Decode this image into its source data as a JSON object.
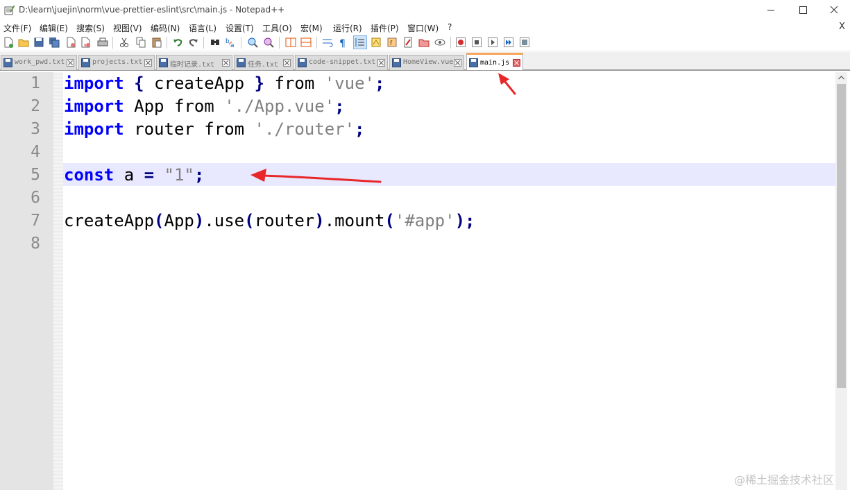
{
  "window": {
    "title": "D:\\learn\\juejin\\norm\\vue-prettier-eslint\\src\\main.js - Notepad++",
    "controls": [
      "minimize",
      "maximize",
      "close"
    ]
  },
  "menu": {
    "items": [
      "文件(F)",
      "编辑(E)",
      "搜索(S)",
      "视图(V)",
      "编码(N)",
      "语言(L)",
      "设置(T)",
      "工具(O)",
      "宏(M)",
      "运行(R)",
      "插件(P)",
      "窗口(W)",
      "?"
    ],
    "close_label": "X"
  },
  "toolbar": {
    "icons": [
      "new-file-icon",
      "open-file-icon",
      "save-icon",
      "save-all-icon",
      "close-icon",
      "close-all-icon",
      "print-icon",
      "cut-icon",
      "copy-icon",
      "paste-icon",
      "undo-icon",
      "redo-icon",
      "find-icon",
      "replace-icon",
      "zoom-in-icon",
      "zoom-out-icon",
      "sync-vertical-icon",
      "sync-horizontal-icon",
      "word-wrap-icon",
      "show-all-chars-icon",
      "indent-guide-icon",
      "udl-icon",
      "function-list-icon",
      "doc-map-icon",
      "folder-workspace-icon",
      "monitoring-icon",
      "record-macro-icon",
      "stop-record-icon",
      "play-macro-icon",
      "run-macro-multiple-icon",
      "save-macro-icon"
    ]
  },
  "tabs": [
    {
      "label": "work_pwd.txt",
      "active": false
    },
    {
      "label": "projects.txt",
      "active": false
    },
    {
      "label": "临时记录.txt",
      "active": false
    },
    {
      "label": "任务.txt",
      "active": false
    },
    {
      "label": "code-snippet.txt",
      "active": false
    },
    {
      "label": "HomeView.vue",
      "active": false
    },
    {
      "label": "main.js",
      "active": true
    }
  ],
  "editor": {
    "line_numbers": [
      "1",
      "2",
      "3",
      "4",
      "5",
      "6",
      "7",
      "8"
    ],
    "current_line": 5,
    "lines": [
      [
        {
          "t": "kw",
          "v": "import"
        },
        {
          "t": "op",
          "v": " {"
        },
        {
          "t": "plain",
          "v": " createApp "
        },
        {
          "t": "op",
          "v": "}"
        },
        {
          "t": "plain",
          "v": " from "
        },
        {
          "t": "str",
          "v": "'vue'"
        },
        {
          "t": "op",
          "v": ";"
        }
      ],
      [
        {
          "t": "kw",
          "v": "import"
        },
        {
          "t": "plain",
          "v": " App from "
        },
        {
          "t": "str",
          "v": "'./App.vue'"
        },
        {
          "t": "op",
          "v": ";"
        }
      ],
      [
        {
          "t": "kw",
          "v": "import"
        },
        {
          "t": "plain",
          "v": " router from "
        },
        {
          "t": "str",
          "v": "'./router'"
        },
        {
          "t": "op",
          "v": ";"
        }
      ],
      [],
      [
        {
          "t": "kw",
          "v": "const"
        },
        {
          "t": "plain",
          "v": " a "
        },
        {
          "t": "op",
          "v": "="
        },
        {
          "t": "plain",
          "v": " "
        },
        {
          "t": "str",
          "v": "\"1\""
        },
        {
          "t": "op",
          "v": ";"
        }
      ],
      [],
      [
        {
          "t": "plain",
          "v": "createApp"
        },
        {
          "t": "op",
          "v": "("
        },
        {
          "t": "plain",
          "v": "App"
        },
        {
          "t": "op",
          "v": ")"
        },
        {
          "t": "plain",
          "v": ".use"
        },
        {
          "t": "op",
          "v": "("
        },
        {
          "t": "plain",
          "v": "router"
        },
        {
          "t": "op",
          "v": ")"
        },
        {
          "t": "plain",
          "v": ".mount"
        },
        {
          "t": "op",
          "v": "("
        },
        {
          "t": "str",
          "v": "'#app'"
        },
        {
          "t": "op",
          "v": ");"
        }
      ],
      []
    ]
  },
  "annotations": {
    "arrow_color": "#e8272a"
  },
  "watermark": "@稀土掘金技术社区"
}
